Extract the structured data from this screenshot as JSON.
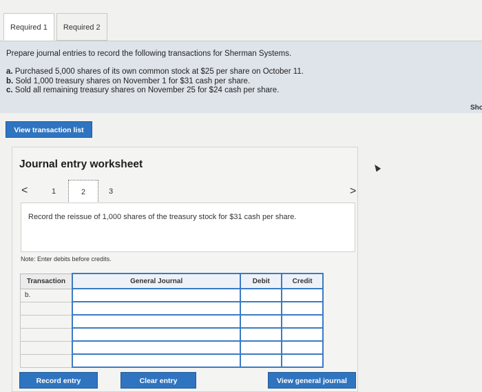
{
  "tabs": [
    {
      "label": "Required 1",
      "active": true
    },
    {
      "label": "Required 2",
      "active": false
    }
  ],
  "instructions": {
    "intro": "Prepare journal entries to record the following transactions for Sherman Systems.",
    "items": [
      {
        "letter": "a.",
        "text": "Purchased 5,000 shares of its own common stock at $25 per share on October 11."
      },
      {
        "letter": "b.",
        "text": "Sold 1,000 treasury shares on November 1 for $31 cash per share."
      },
      {
        "letter": "c.",
        "text": "Sold all remaining treasury shares on November 25 for $24 cash per share."
      }
    ]
  },
  "side_text": "Sho",
  "view_transaction_list": "View transaction list",
  "worksheet": {
    "title": "Journal entry worksheet",
    "pager": {
      "prev": "<",
      "pages": [
        "1",
        "2",
        "3"
      ],
      "current": "2",
      "next": ">"
    },
    "description": "Record the reissue of 1,000 shares of the treasury stock for $31 cash per share.",
    "note": "Note: Enter debits before credits.",
    "table": {
      "headers": {
        "transaction": "Transaction",
        "account": "General Journal",
        "debit": "Debit",
        "credit": "Credit"
      },
      "rows": [
        {
          "transaction": "b.",
          "account": "",
          "debit": "",
          "credit": ""
        },
        {
          "transaction": "",
          "account": "",
          "debit": "",
          "credit": ""
        },
        {
          "transaction": "",
          "account": "",
          "debit": "",
          "credit": ""
        },
        {
          "transaction": "",
          "account": "",
          "debit": "",
          "credit": ""
        },
        {
          "transaction": "",
          "account": "",
          "debit": "",
          "credit": ""
        },
        {
          "transaction": "",
          "account": "",
          "debit": "",
          "credit": ""
        }
      ]
    },
    "buttons": {
      "record": "Record entry",
      "clear": "Clear entry",
      "view_journal": "View general journal"
    }
  },
  "colors": {
    "accent": "#2f74c0",
    "panel": "#dfe4ea",
    "input_border": "#3a7ac4"
  }
}
